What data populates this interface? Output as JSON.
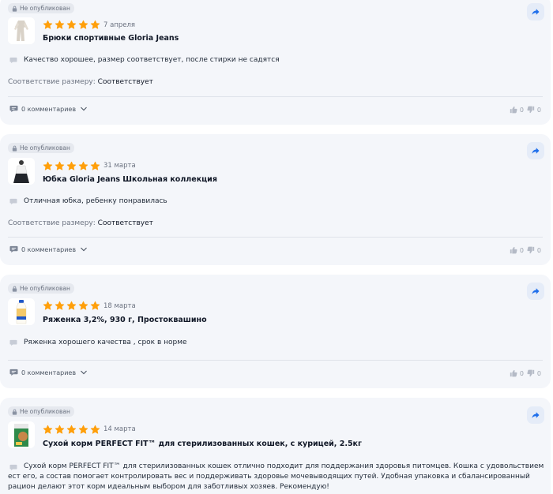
{
  "colors": {
    "star": "#ff9f0a",
    "accent": "#1f6feb",
    "card_bg": "#f4f6fa"
  },
  "reviews": [
    {
      "status": "Не опубликован",
      "date": "7 апреля",
      "rating": 5,
      "product": "Брюки спортивные Gloria Jeans",
      "text": "Качество хорошее, размер соответствует, после стирки не садятся",
      "size_label": "Соответствие размеру:",
      "size_value": "Соответствует",
      "comments": "0 комментариев",
      "likes": "0",
      "dislikes": "0"
    },
    {
      "status": "Не опубликован",
      "date": "31 марта",
      "rating": 5,
      "product": "Юбка Gloria Jeans Школьная коллекция",
      "text": "Отличная юбка, ребенку понравилась",
      "size_label": "Соответствие размеру:",
      "size_value": "Соответствует",
      "comments": "0 комментариев",
      "likes": "0",
      "dislikes": "0"
    },
    {
      "status": "Не опубликован",
      "date": "18 марта",
      "rating": 5,
      "product": "Ряженка 3,2%, 930 г, Простоквашино",
      "text": "Ряженка хорошего качества , срок в норме",
      "comments": "0 комментариев",
      "likes": "0",
      "dislikes": "0"
    },
    {
      "status": "Не опубликован",
      "date": "14 марта",
      "rating": 5,
      "product": "Сухой корм PERFECT FIT™ для стерилизованных кошек, с курицей, 2.5кг",
      "text": "Сухой корм PERFECT FIT™ для стерилизованных кошек отлично подходит для поддержания здоровья питомцев. Кошка с удовольствием ест его, а состав помогает контролировать вес и поддерживать здоровье мочевыводящих путей. Удобная упаковка и сбалансированный рацион делают этот корм идеальным выбором для заботливых хозяев. Рекомендую!"
    }
  ]
}
